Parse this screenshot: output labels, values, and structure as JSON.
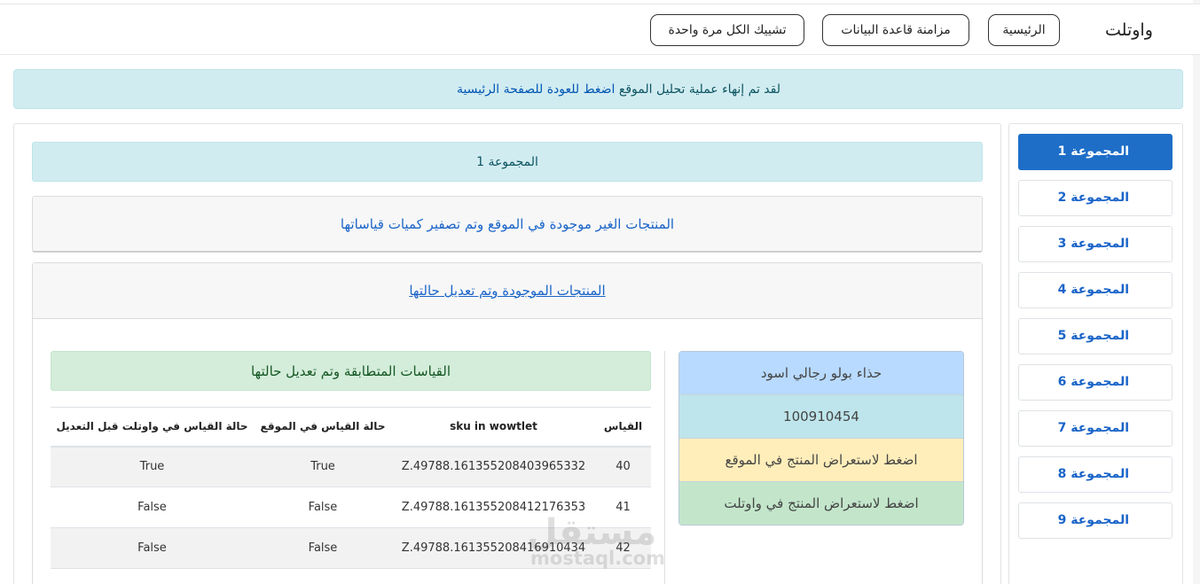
{
  "nav": {
    "brand": "واوتلت",
    "home": "الرئيسية",
    "sync_db": "مزامنة قاعدة البيانات",
    "check_all": "تشييك الكل مرة واحدة"
  },
  "alert": {
    "text": "لقد تم إنهاء عملية تحليل الموقع",
    "link": "اضغط للعودة للصفحة الرئيسية"
  },
  "groups": [
    {
      "label": "المجموعة 1",
      "active": true
    },
    {
      "label": "المجموعة 2",
      "active": false
    },
    {
      "label": "المجموعة 3",
      "active": false
    },
    {
      "label": "المجموعة 4",
      "active": false
    },
    {
      "label": "المجموعة 5",
      "active": false
    },
    {
      "label": "المجموعة 6",
      "active": false
    },
    {
      "label": "المجموعة 7",
      "active": false
    },
    {
      "label": "المجموعة 8",
      "active": false
    },
    {
      "label": "المجموعة 9",
      "active": false
    }
  ],
  "main": {
    "group_title": "المجموعة 1",
    "missing_products": "المنتجات الغير موجودة في الموقع وتم تصفير كميات قياساتها",
    "existing_products": "المنتجات الموجودة وتم تعديل حالتها"
  },
  "product": {
    "name": "حذاء بولو رجالي اسود",
    "sku": "100910454",
    "view_on_site": "اضغط لاستعراض المنتج في الموقع",
    "view_on_wowtlet": "اضغط لاستعراض المنتج في واوتلت"
  },
  "matched_sizes": {
    "title": "القياسات المتطابقة وتم تعديل حالتها",
    "headers": {
      "size": "القياس",
      "sku": "sku in wowtlet",
      "site_status": "حالة القياس في الموقع",
      "before_status": "حالة القياس في واوتلت قبل التعديل"
    },
    "rows": [
      {
        "size": "40",
        "sku": "Z.49788.161355208403965332",
        "site_status": "True",
        "before_status": "True"
      },
      {
        "size": "41",
        "sku": "Z.49788.161355208412176353",
        "site_status": "False",
        "before_status": "False"
      },
      {
        "size": "42",
        "sku": "Z.49788.161355208416910434",
        "site_status": "False",
        "before_status": "False"
      }
    ]
  },
  "watermark": {
    "text": "مستقل",
    "sub": "mostaql.com"
  }
}
